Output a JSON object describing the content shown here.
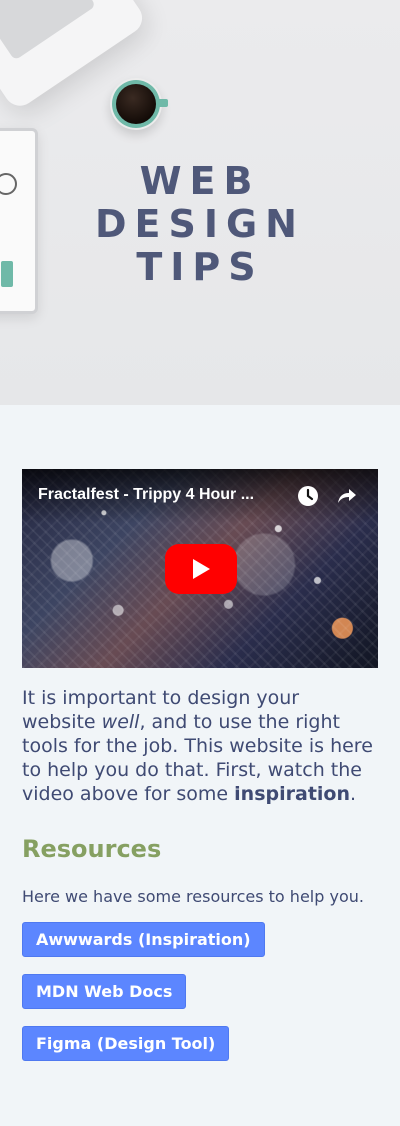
{
  "hero": {
    "title": "WEB DESIGN TIPS"
  },
  "video": {
    "title": "Fractalfest - Trippy 4 Hour ...",
    "icons": {
      "play": "play-icon",
      "clock": "clock-icon",
      "share": "share-icon"
    },
    "colors": {
      "play_button": "#ff0000",
      "video_text": "#ffffff"
    }
  },
  "main": {
    "intro": {
      "part1": "It is important to design your website ",
      "emphasis": "well",
      "part2": ", and to use the right tools for the job. This website is here to help you do that. First, watch the video above for some ",
      "strong": "inspiration",
      "part3": "."
    },
    "resources": {
      "heading": "Resources",
      "description": "Here we have some resources to help you.",
      "links": [
        {
          "label": "Awwwards (Inspiration)"
        },
        {
          "label": "MDN Web Docs"
        },
        {
          "label": "Figma (Design Tool)"
        }
      ]
    }
  },
  "colors": {
    "page_background": "#f1f5f8",
    "text": "#3f4a73",
    "accent": "#86a062",
    "button": "#5c86ff"
  }
}
